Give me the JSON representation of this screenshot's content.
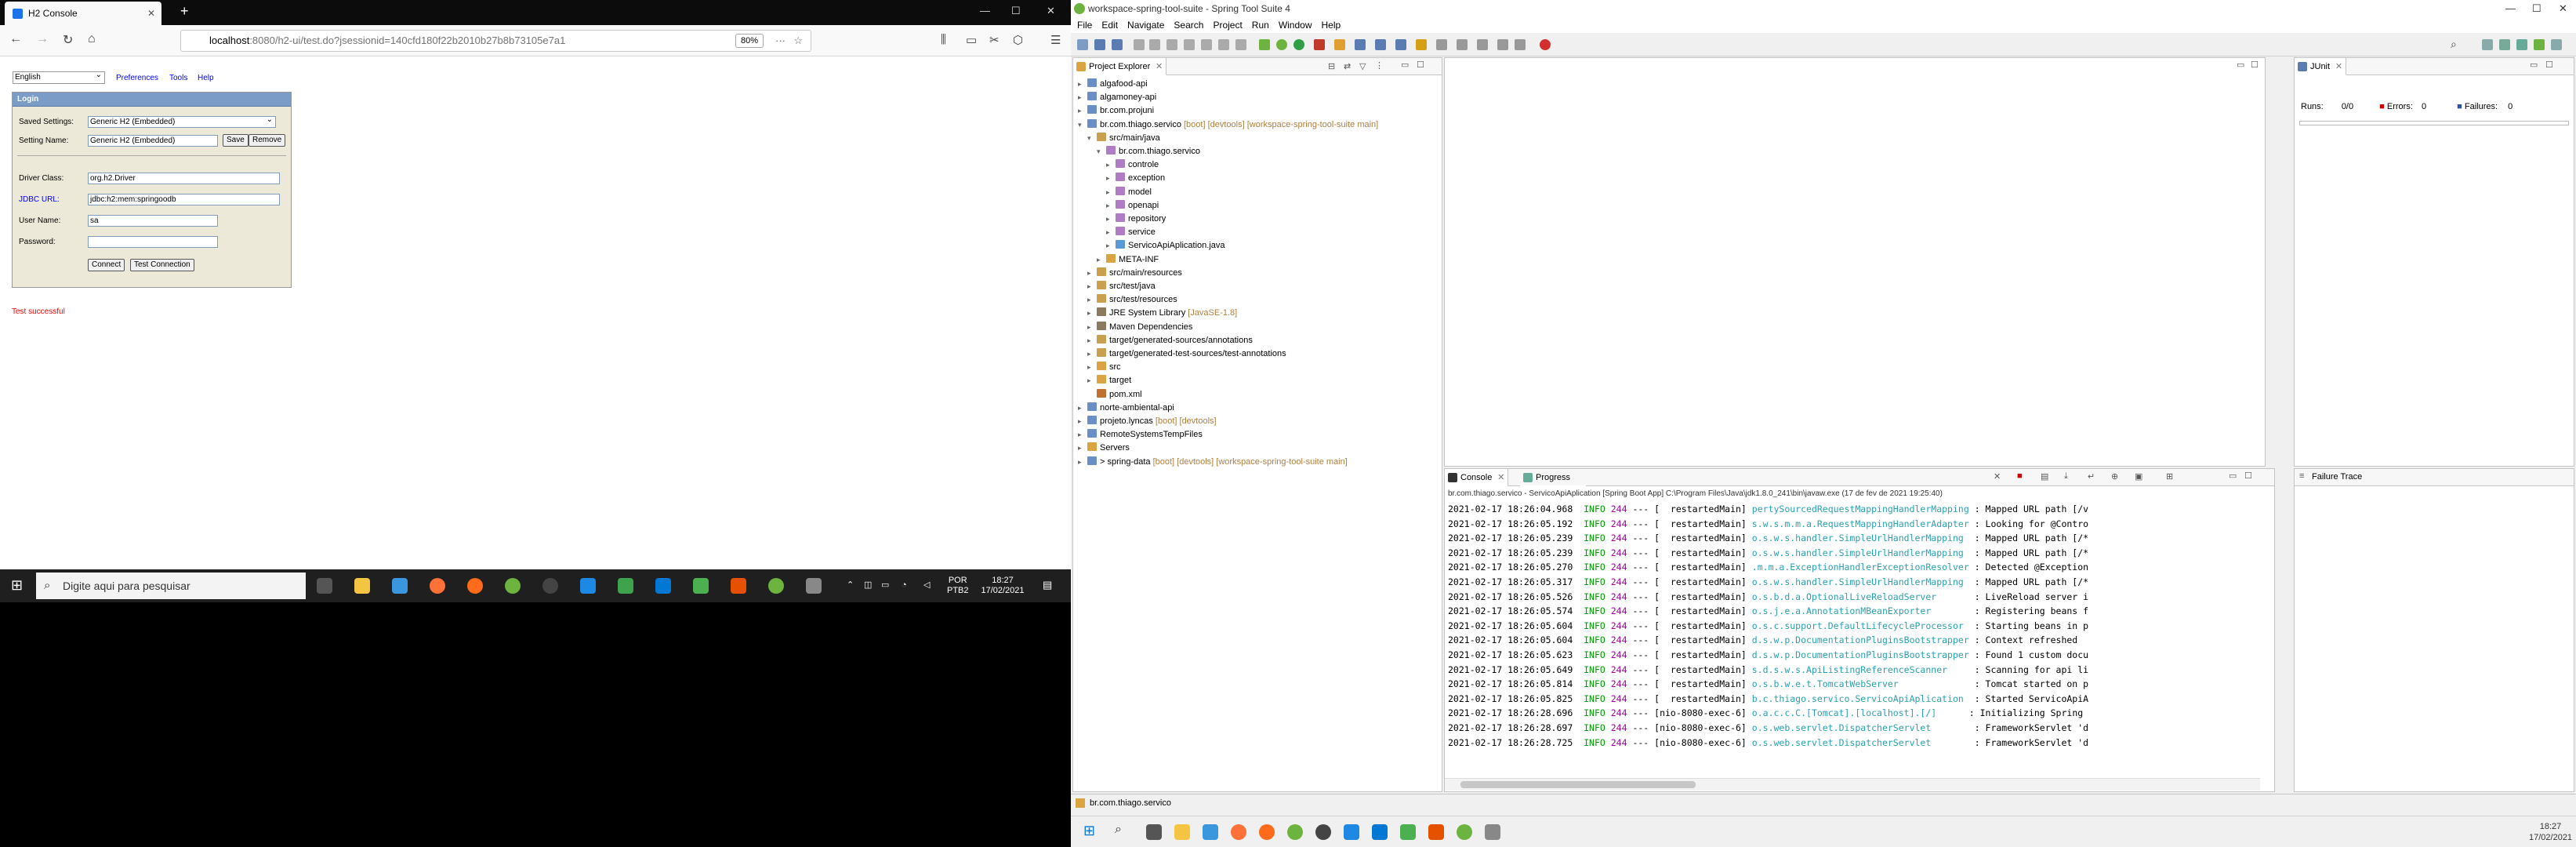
{
  "left_screen": {
    "browser": {
      "tab_title": "H2 Console",
      "url_host": "localhost",
      "url_rest": ":8080/h2-ui/test.do?jsessionid=140cfd180f22b2010b27b8b73105e7a1",
      "zoom": "80%"
    },
    "h2": {
      "language": "English",
      "links": [
        "Preferences",
        "Tools",
        "Help"
      ],
      "login_header": "Login",
      "saved_settings_label": "Saved Settings:",
      "saved_settings_value": "Generic H2 (Embedded)",
      "setting_name_label": "Setting Name:",
      "setting_name_value": "Generic H2 (Embedded)",
      "save_label": "Save",
      "remove_label": "Remove",
      "driver_class_label": "Driver Class:",
      "driver_class_value": "org.h2.Driver",
      "jdbc_url_label": "JDBC URL:",
      "jdbc_url_value": "jdbc:h2:mem:springoodb",
      "user_name_label": "User Name:",
      "user_name_value": "sa",
      "password_label": "Password:",
      "password_value": "",
      "connect_label": "Connect",
      "test_connection_label": "Test Connection",
      "test_result": "Test successful"
    },
    "taskbar": {
      "search_placeholder": "Digite aqui para pesquisar",
      "lang_top": "POR",
      "lang_bottom": "PTB2",
      "time": "18:27",
      "date": "17/02/2021"
    }
  },
  "ide": {
    "window_title": "workspace-spring-tool-suite - Spring Tool Suite 4",
    "menu": [
      "File",
      "Edit",
      "Navigate",
      "Search",
      "Project",
      "Run",
      "Window",
      "Help"
    ],
    "explorer": {
      "tab": "Project Explorer",
      "items": [
        {
          "label": "algafood-api",
          "deco": ""
        },
        {
          "label": "algamoney-api",
          "deco": ""
        },
        {
          "label": "br.com.projuni",
          "deco": ""
        },
        {
          "label": "br.com.thiago.servico",
          "deco": " [boot] [devtools] [workspace-spring-tool-suite main]"
        },
        {
          "label": "src/main/java",
          "deco": ""
        },
        {
          "label": "br.com.thiago.servico",
          "deco": ""
        },
        {
          "label": "controle",
          "deco": ""
        },
        {
          "label": "exception",
          "deco": ""
        },
        {
          "label": "model",
          "deco": ""
        },
        {
          "label": "openapi",
          "deco": ""
        },
        {
          "label": "repository",
          "deco": ""
        },
        {
          "label": "service",
          "deco": ""
        },
        {
          "label": "ServicoApiAplication.java",
          "deco": ""
        },
        {
          "label": "META-INF",
          "deco": ""
        },
        {
          "label": "src/main/resources",
          "deco": ""
        },
        {
          "label": "src/test/java",
          "deco": ""
        },
        {
          "label": "src/test/resources",
          "deco": ""
        },
        {
          "label": "JRE System Library",
          "deco": " [JavaSE-1.8]"
        },
        {
          "label": "Maven Dependencies",
          "deco": ""
        },
        {
          "label": "target/generated-sources/annotations",
          "deco": ""
        },
        {
          "label": "target/generated-test-sources/test-annotations",
          "deco": ""
        },
        {
          "label": "src",
          "deco": ""
        },
        {
          "label": "target",
          "deco": ""
        },
        {
          "label": "pom.xml",
          "deco": ""
        },
        {
          "label": "norte-ambiental-api",
          "deco": ""
        },
        {
          "label": "projeto.lyncas",
          "deco": " [boot] [devtools]"
        },
        {
          "label": "RemoteSystemsTempFiles",
          "deco": ""
        },
        {
          "label": "Servers",
          "deco": ""
        },
        {
          "label": "> spring-data",
          "deco": " [boot] [devtools] [workspace-spring-tool-suite main]"
        }
      ]
    },
    "junit": {
      "tab": "JUnit",
      "runs_label": "Runs:",
      "runs_value": "0/0",
      "errors_label": "Errors:",
      "errors_value": "0",
      "failures_label": "Failures:",
      "failures_value": "0",
      "failure_trace": "Failure Trace"
    },
    "console": {
      "tab": "Console",
      "progress_tab": "Progress",
      "header": "br.com.thiago.servico - ServicoApiAplication [Spring Boot App] C:\\Program Files\\Java\\jdk1.8.0_241\\bin\\javaw.exe  (17 de fev de 2021 19:25:40)",
      "lines": [
        {
          "ts": "2021-02-17 18:26:04.968",
          "level": "INFO",
          "pid": "244",
          "thread": "[  restartedMain]",
          "logger": "pertySourcedRequestMappingHandlerMapping",
          "msg": ": Mapped URL path [/v"
        },
        {
          "ts": "2021-02-17 18:26:05.192",
          "level": "INFO",
          "pid": "244",
          "thread": "[  restartedMain]",
          "logger": "s.w.s.m.m.a.RequestMappingHandlerAdapter",
          "msg": ": Looking for @Contro"
        },
        {
          "ts": "2021-02-17 18:26:05.239",
          "level": "INFO",
          "pid": "244",
          "thread": "[  restartedMain]",
          "logger": "o.s.w.s.handler.SimpleUrlHandlerMapping ",
          "msg": ": Mapped URL path [/*"
        },
        {
          "ts": "2021-02-17 18:26:05.239",
          "level": "INFO",
          "pid": "244",
          "thread": "[  restartedMain]",
          "logger": "o.s.w.s.handler.SimpleUrlHandlerMapping ",
          "msg": ": Mapped URL path [/*"
        },
        {
          "ts": "2021-02-17 18:26:05.270",
          "level": "INFO",
          "pid": "244",
          "thread": "[  restartedMain]",
          "logger": ".m.m.a.ExceptionHandlerExceptionResolver",
          "msg": ": Detected @Exception"
        },
        {
          "ts": "2021-02-17 18:26:05.317",
          "level": "INFO",
          "pid": "244",
          "thread": "[  restartedMain]",
          "logger": "o.s.w.s.handler.SimpleUrlHandlerMapping ",
          "msg": ": Mapped URL path [/*"
        },
        {
          "ts": "2021-02-17 18:26:05.526",
          "level": "INFO",
          "pid": "244",
          "thread": "[  restartedMain]",
          "logger": "o.s.b.d.a.OptionalLiveReloadServer      ",
          "msg": ": LiveReload server i"
        },
        {
          "ts": "2021-02-17 18:26:05.574",
          "level": "INFO",
          "pid": "244",
          "thread": "[  restartedMain]",
          "logger": "o.s.j.e.a.AnnotationMBeanExporter       ",
          "msg": ": Registering beans f"
        },
        {
          "ts": "2021-02-17 18:26:05.604",
          "level": "INFO",
          "pid": "244",
          "thread": "[  restartedMain]",
          "logger": "o.s.c.support.DefaultLifecycleProcessor ",
          "msg": ": Starting beans in p"
        },
        {
          "ts": "2021-02-17 18:26:05.604",
          "level": "INFO",
          "pid": "244",
          "thread": "[  restartedMain]",
          "logger": "d.s.w.p.DocumentationPluginsBootstrapper",
          "msg": ": Context refreshed"
        },
        {
          "ts": "2021-02-17 18:26:05.623",
          "level": "INFO",
          "pid": "244",
          "thread": "[  restartedMain]",
          "logger": "d.s.w.p.DocumentationPluginsBootstrapper",
          "msg": ": Found 1 custom docu"
        },
        {
          "ts": "2021-02-17 18:26:05.649",
          "level": "INFO",
          "pid": "244",
          "thread": "[  restartedMain]",
          "logger": "s.d.s.w.s.ApiListingReferenceScanner    ",
          "msg": ": Scanning for api li"
        },
        {
          "ts": "2021-02-17 18:26:05.814",
          "level": "INFO",
          "pid": "244",
          "thread": "[  restartedMain]",
          "logger": "o.s.b.w.e.t.TomcatWebServer             ",
          "msg": ": Tomcat started on p"
        },
        {
          "ts": "2021-02-17 18:26:05.825",
          "level": "INFO",
          "pid": "244",
          "thread": "[  restartedMain]",
          "logger": "b.c.thiago.servico.ServicoApiAplication ",
          "msg": ": Started ServicoApiA"
        },
        {
          "ts": "2021-02-17 18:26:28.696",
          "level": "INFO",
          "pid": "244",
          "thread": "[nio-8080-exec-6]",
          "logger": "o.a.c.c.C.[Tomcat].[localhost].[/]     ",
          "msg": ": Initializing Spring"
        },
        {
          "ts": "2021-02-17 18:26:28.697",
          "level": "INFO",
          "pid": "244",
          "thread": "[nio-8080-exec-6]",
          "logger": "o.s.web.servlet.DispatcherServlet       ",
          "msg": ": FrameworkServlet 'd"
        },
        {
          "ts": "2021-02-17 18:26:28.725",
          "level": "INFO",
          "pid": "244",
          "thread": "[nio-8080-exec-6]",
          "logger": "o.s.web.servlet.DispatcherServlet       ",
          "msg": ": FrameworkServlet 'd"
        }
      ]
    },
    "status": "br.com.thiago.servico",
    "taskbar": {
      "time": "18:27",
      "date": "17/02/2021"
    }
  },
  "colors": {
    "accent_blue": "#0078d7",
    "log_info": "#00a000",
    "log_logger": "#2aa1b3",
    "error_red": "#ff0000"
  }
}
